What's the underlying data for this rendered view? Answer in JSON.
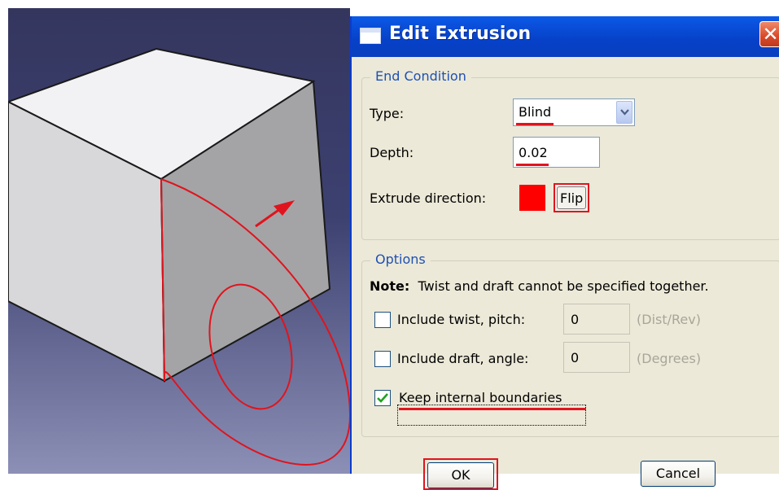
{
  "dialog": {
    "title": "Edit Extrusion",
    "close_symbol": "✕",
    "end_condition": {
      "legend": "End Condition",
      "type_label": "Type:",
      "type_value": "Blind",
      "depth_label": "Depth:",
      "depth_value": "0.02",
      "direction_label": "Extrude direction:",
      "flip_label": "Flip"
    },
    "options": {
      "legend": "Options",
      "note_bold": "Note:",
      "note_text": "Twist and draft cannot be specified together.",
      "twist_label": "Include twist, pitch:",
      "twist_value": "0",
      "twist_unit": "(Dist/Rev)",
      "twist_checked": false,
      "draft_label": "Include draft, angle:",
      "draft_value": "0",
      "draft_unit": "(Degrees)",
      "draft_checked": false,
      "keep_label": "Keep internal boundaries",
      "keep_checked": true
    },
    "ok_label": "OK",
    "cancel_label": "Cancel"
  },
  "colors": {
    "highlight": "#e0141e",
    "titlebar": "#0a50dc",
    "dialog_bg": "#ece9d8",
    "viewport_top": "#34365e",
    "viewport_bottom": "#8c90b6"
  },
  "icons": {
    "title": "window-icon",
    "close": "close-icon",
    "dropdown": "chevron-down-icon",
    "check": "check-icon"
  }
}
